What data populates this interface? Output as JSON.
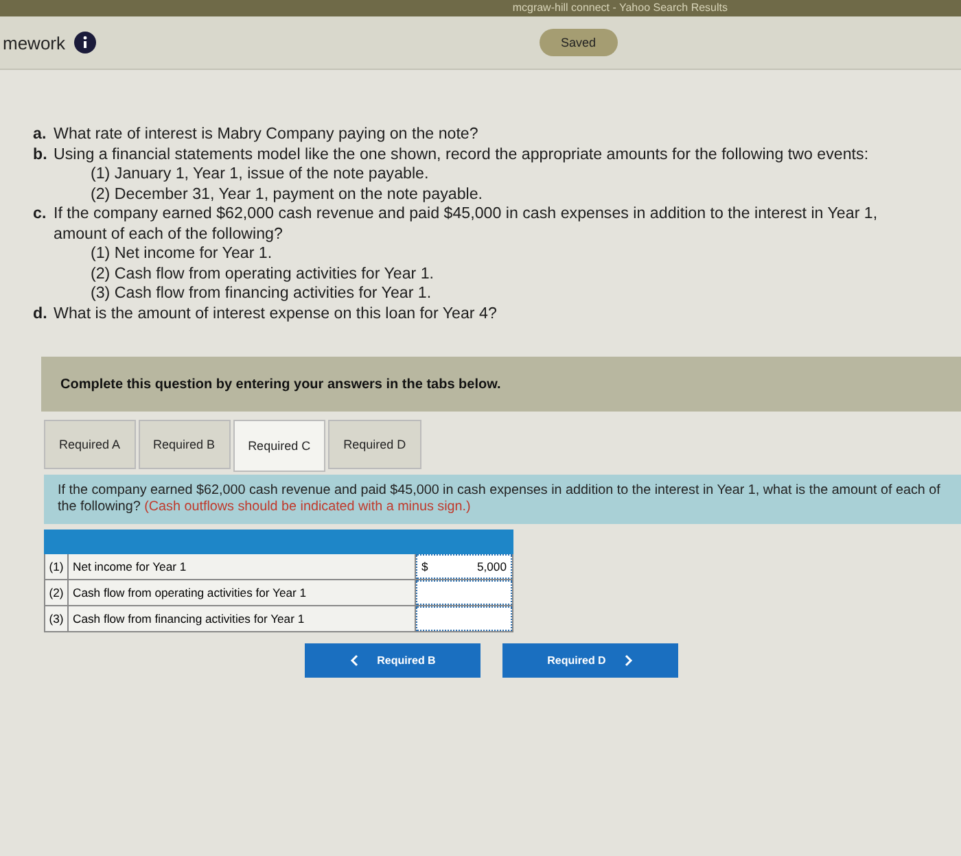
{
  "browser_tab": {
    "title": "mcgraw-hill connect - Yahoo Search Results"
  },
  "header": {
    "title": "mework",
    "status": "Saved"
  },
  "questions": [
    {
      "marker": "a.",
      "text": "What rate of interest is Mabry Company paying on the note?"
    },
    {
      "marker": "b.",
      "text": "Using a financial statements model like the one shown, record the appropriate amounts for the following two events:",
      "subitems": [
        "(1) January 1, Year 1, issue of the note payable.",
        "(2) December 31, Year 1, payment on the note payable."
      ]
    },
    {
      "marker": "c.",
      "text": "If the company earned $62,000 cash revenue and paid $45,000 in cash expenses in addition to the interest in Year 1,",
      "continuation": "amount of each of the following?",
      "subitems": [
        "(1) Net income for Year 1.",
        "(2) Cash flow from operating activities for Year 1.",
        "(3) Cash flow from financing activities for Year 1."
      ]
    },
    {
      "marker": "d.",
      "text": "What is the amount of interest expense on this loan for Year 4?"
    }
  ],
  "instruction": "Complete this question by entering your answers in the tabs below.",
  "tabs": [
    {
      "label": "Required A",
      "selected": false
    },
    {
      "label": "Required B",
      "selected": false
    },
    {
      "label": "Required C",
      "selected": true
    },
    {
      "label": "Required D",
      "selected": false
    }
  ],
  "prompt": {
    "text": "If the company earned $62,000 cash revenue and paid $45,000 in cash expenses in addition to the interest in Year 1, what is the amount of each of the following?",
    "note": "(Cash outflows should be indicated with a minus sign.)"
  },
  "table": {
    "rows": [
      {
        "number": "(1)",
        "label": "Net income for Year 1",
        "currency": "$",
        "value": "5,000"
      },
      {
        "number": "(2)",
        "label": "Cash flow from operating activities for Year 1",
        "currency": "",
        "value": ""
      },
      {
        "number": "(3)",
        "label": "Cash flow from financing activities for Year 1",
        "currency": "",
        "value": ""
      }
    ]
  },
  "nav": {
    "prev": "Required B",
    "next": "Required D"
  }
}
